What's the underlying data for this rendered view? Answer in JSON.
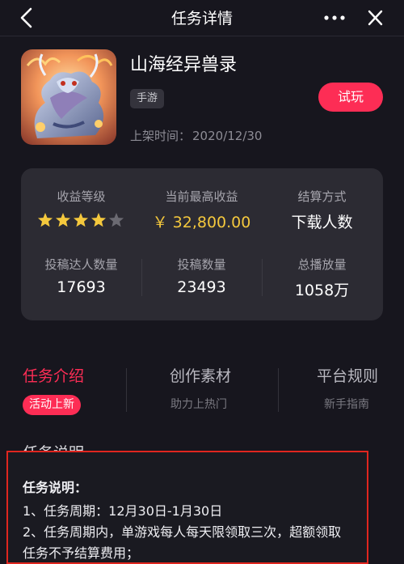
{
  "nav": {
    "title": "任务详情",
    "back_icon": "chevron-left-icon",
    "more_icon": "more-dots-icon",
    "close_icon": "close-icon"
  },
  "app": {
    "name": "山海经异兽录",
    "tag": "手游",
    "try_label": "试玩",
    "release_label": "上架时间：",
    "release_date": "2020/12/30",
    "icon": "dragon-game-icon"
  },
  "stats": {
    "revenue_level_label": "收益等级",
    "revenue_level_stars": 4,
    "revenue_level_max": 5,
    "max_revenue_label": "当前最高收益",
    "max_revenue_value": "￥ 32,800.00",
    "settlement_label": "结算方式",
    "settlement_value": "下载人数",
    "creators_label": "投稿达人数量",
    "creators_value": "17693",
    "submissions_label": "投稿数量",
    "submissions_value": "23493",
    "plays_label": "总播放量",
    "plays_value": "1058万"
  },
  "tabs": [
    {
      "title": "任务介绍",
      "badge": "活动上新"
    },
    {
      "title": "创作素材",
      "subtitle": "助力上热门"
    },
    {
      "title": "平台规则",
      "subtitle": "新手指南"
    }
  ],
  "description": {
    "section_title": "任务说明",
    "heading": "任务说明：",
    "lines": [
      "1、任务周期：12月30日-1月30日",
      "2、任务周期内，单游戏每人每天限领取三次，超额领取",
      "任务不予结算费用；"
    ]
  },
  "colors": {
    "accent": "#fd2d55",
    "gold": "#f4c83d",
    "background": "#17161e",
    "card": "#2c2b33",
    "highlight_border": "#e0261f"
  }
}
